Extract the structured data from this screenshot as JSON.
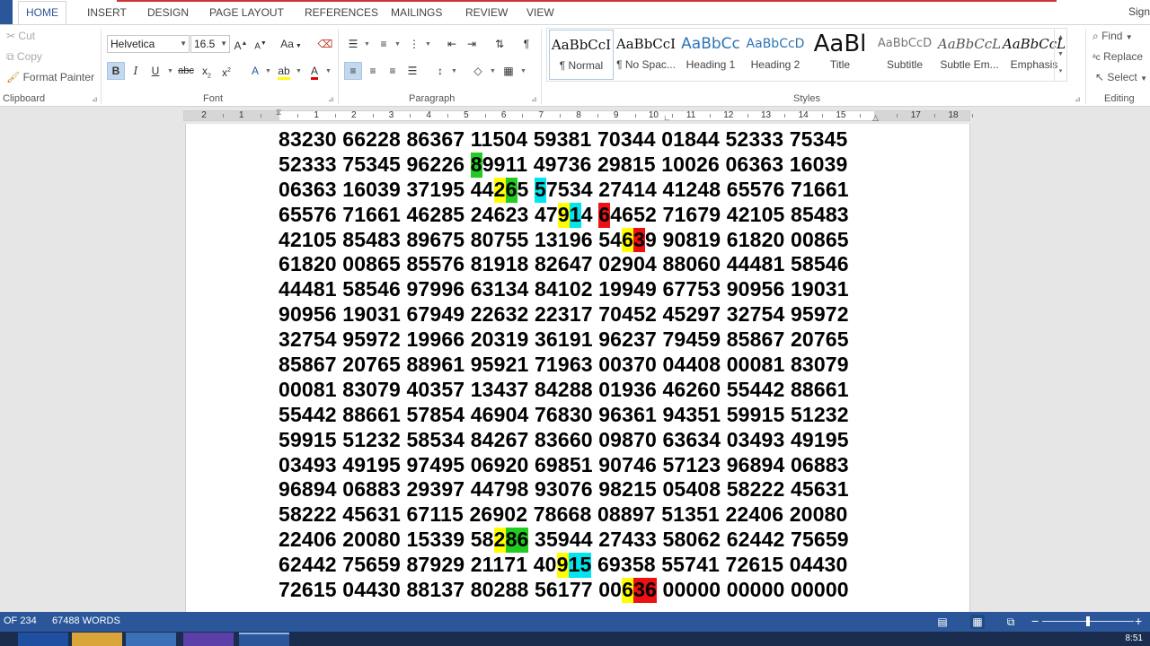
{
  "tabs": [
    "HOME",
    "INSERT",
    "DESIGN",
    "PAGE LAYOUT",
    "REFERENCES",
    "MAILINGS",
    "REVIEW",
    "VIEW"
  ],
  "active_tab": "HOME",
  "sign_in": "Sign",
  "clipboard": {
    "cut": "Cut",
    "copy": "Copy",
    "format_painter": "Format Painter",
    "label": "Clipboard"
  },
  "font": {
    "name": "Helvetica",
    "size": "16.5",
    "change_case": "Aa",
    "label": "Font"
  },
  "paragraph": {
    "label": "Paragraph"
  },
  "styles": {
    "label": "Styles",
    "items": [
      {
        "sample": "AaBbCcI",
        "name": "¶ Normal"
      },
      {
        "sample": "AaBbCcI",
        "name": "¶ No Spac..."
      },
      {
        "sample": "AaBbCc",
        "name": "Heading 1"
      },
      {
        "sample": "AaBbCcD",
        "name": "Heading 2"
      },
      {
        "sample": "AaBl",
        "name": "Title"
      },
      {
        "sample": "AaBbCcD",
        "name": "Subtitle"
      },
      {
        "sample": "AaBbCcL",
        "name": "Subtle Em..."
      },
      {
        "sample": "AaBbCcL",
        "name": "Emphasis"
      }
    ]
  },
  "editing": {
    "find": "Find",
    "replace": "Replace",
    "select": "Select",
    "label": "Editing"
  },
  "ruler_numbers": [
    "2",
    "1",
    "",
    "1",
    "2",
    "3",
    "4",
    "5",
    "6",
    "7",
    "8",
    "9",
    "10",
    "11",
    "12",
    "13",
    "14",
    "15",
    "",
    "17",
    "18"
  ],
  "document_lines": [
    [
      {
        "t": "83230 66228 86367 11504 59381 70344 01844 52333 75345"
      }
    ],
    [
      {
        "t": "52333 75345 96226 "
      },
      {
        "t": "8",
        "bg": "#22cc22"
      },
      {
        "t": "9911 49736 29815 10026 06363 16039"
      }
    ],
    [
      {
        "t": "06363 16039 37195 44"
      },
      {
        "t": "2",
        "bg": "#ffff00"
      },
      {
        "t": "6",
        "bg": "#22cc22"
      },
      {
        "t": "5 "
      },
      {
        "t": "5",
        "bg": "#00e5ee"
      },
      {
        "t": "7534 27414 41248 65576 71661"
      }
    ],
    [
      {
        "t": "65576 71661 46285 24623 47"
      },
      {
        "t": "9",
        "bg": "#ffff00"
      },
      {
        "t": "1",
        "bg": "#00e5ee"
      },
      {
        "t": "4 "
      },
      {
        "t": "6",
        "bg": "#ee1111"
      },
      {
        "t": "4652 71679 42105 85483"
      }
    ],
    [
      {
        "t": "42105 85483 89675 80755 13196 54"
      },
      {
        "t": "6",
        "bg": "#ffff00"
      },
      {
        "t": "3",
        "bg": "#ee1111"
      },
      {
        "t": "9 90819 61820 00865"
      }
    ],
    [
      {
        "t": "61820 00865 85576 81918 82647 02904 88060 44481 58546"
      }
    ],
    [
      {
        "t": "44481 58546 97996 63134 84102 19949 67753 90956 19031"
      }
    ],
    [
      {
        "t": "90956 19031 67949 22632 22317 70452 45297 32754 95972"
      }
    ],
    [
      {
        "t": "32754 95972 19966 20319 36191 96237 79459 85867 20765"
      }
    ],
    [
      {
        "t": "85867 20765 88961 95921 71963 00370 04408 00081 83079"
      }
    ],
    [
      {
        "t": "00081 83079 40357 13437 84288 01936 46260 55442 88661"
      }
    ],
    [
      {
        "t": "55442 88661 57854 46904 76830 96361 94351 59915 51232"
      }
    ],
    [
      {
        "t": "59915 51232 58534 84267 83660 09870 63634 03493 49195"
      }
    ],
    [
      {
        "t": "03493 49195 97495 06920 69851 90746 57123 96894 06883"
      }
    ],
    [
      {
        "t": "96894 06883 29397 44798 93076 98215 05408 58222 45631"
      }
    ],
    [
      {
        "t": "58222 45631 67115 26902 78668 08897 51351 22406 20080"
      }
    ],
    [
      {
        "t": "22406 20080 15339 58"
      },
      {
        "t": "2",
        "bg": "#ffff00"
      },
      {
        "t": "86",
        "bg": "#22cc22"
      },
      {
        "t": " 35944 27433 58062 62442 75659"
      }
    ],
    [
      {
        "t": "62442 75659 87929 21171 40"
      },
      {
        "t": "9",
        "bg": "#ffff00"
      },
      {
        "t": "15",
        "bg": "#00e5ee"
      },
      {
        "t": " 69358 55741 72615 04430"
      }
    ],
    [
      {
        "t": "72615 04430 88137 80288 56177 00"
      },
      {
        "t": "6",
        "bg": "#ffff00"
      },
      {
        "t": "36",
        "bg": "#ee1111"
      },
      {
        "t": " 00000 00000 00000"
      }
    ]
  ],
  "status": {
    "page": "OF 234",
    "words": "67488 WORDS"
  },
  "clock": "8:51",
  "colors": {
    "brand": "#2b579a",
    "highlight_yellow": "#ffff00",
    "highlight_green": "#22cc22",
    "highlight_cyan": "#00e5ee",
    "highlight_red": "#ee1111"
  }
}
